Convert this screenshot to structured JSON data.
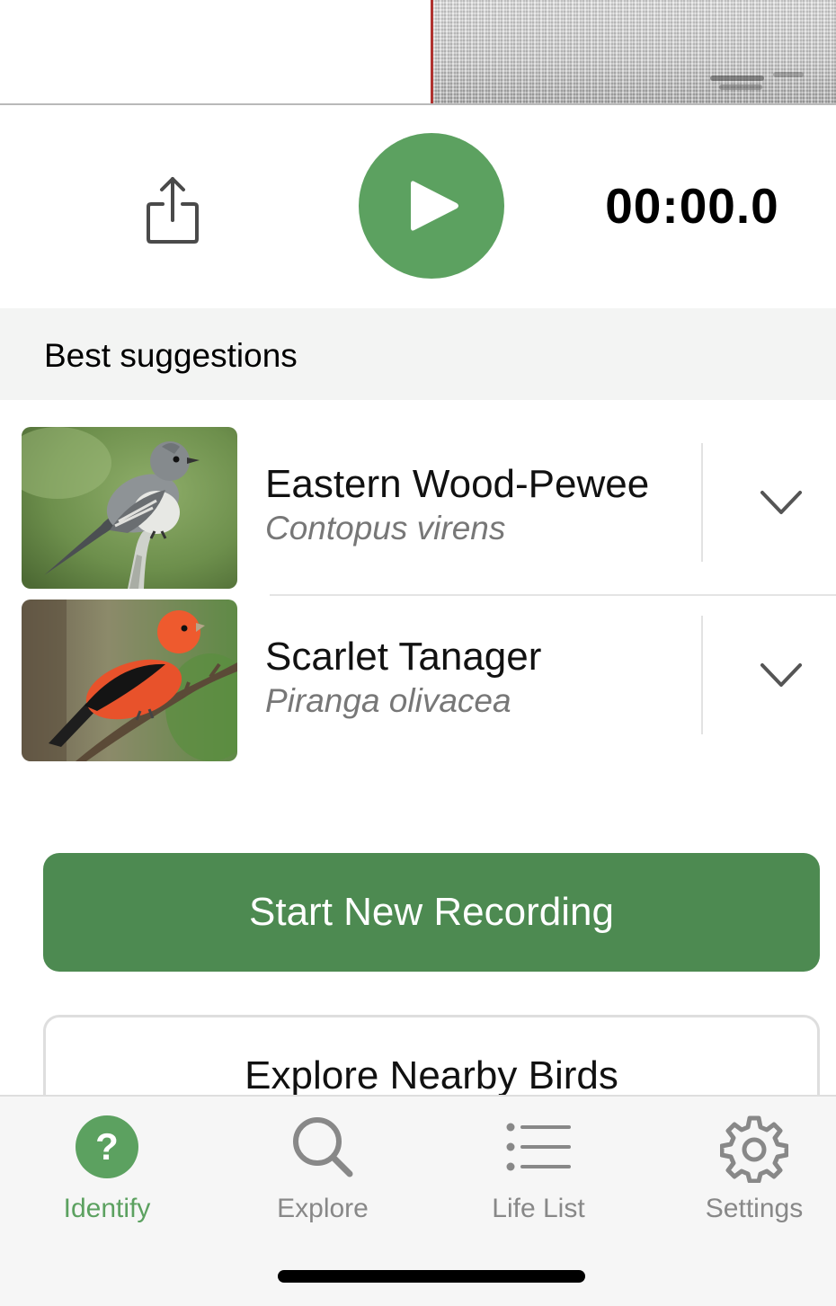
{
  "player": {
    "timer": "00:00.0",
    "share_icon": "share-icon",
    "play_icon": "play-icon",
    "accent_color": "#5ca160"
  },
  "suggestions": {
    "header": "Best suggestions",
    "items": [
      {
        "common_name": "Eastern Wood-Pewee",
        "scientific_name": "Contopus virens",
        "image": "bird-photo",
        "expand_icon": "chevron-down-icon"
      },
      {
        "common_name": "Scarlet Tanager",
        "scientific_name": "Piranga olivacea",
        "image": "bird-photo",
        "expand_icon": "chevron-down-icon"
      }
    ]
  },
  "actions": {
    "start_recording": "Start New Recording",
    "explore_nearby": "Explore Nearby Birds",
    "primary_color": "#4d8a51"
  },
  "tabbar": {
    "tabs": [
      {
        "label": "Identify",
        "icon": "question-icon",
        "active": true
      },
      {
        "label": "Explore",
        "icon": "search-icon",
        "active": false
      },
      {
        "label": "Life List",
        "icon": "list-icon",
        "active": false
      },
      {
        "label": "Settings",
        "icon": "gear-icon",
        "active": false
      }
    ]
  }
}
